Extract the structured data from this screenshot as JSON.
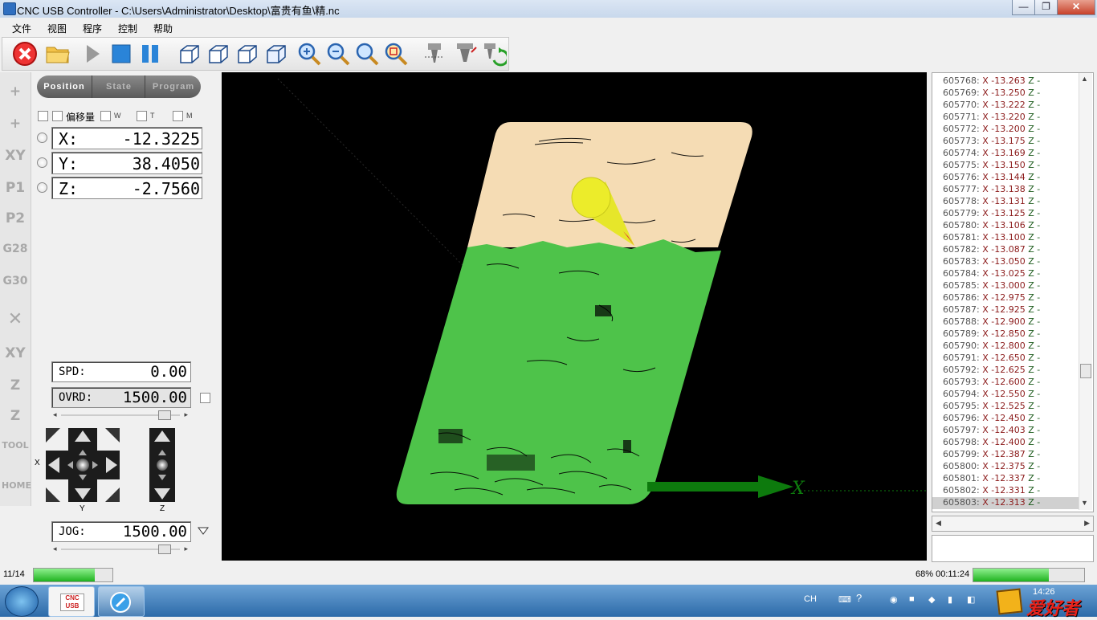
{
  "window": {
    "title": "CNC USB Controller - C:\\Users\\Administrator\\Desktop\\富贵有鱼\\精.nc",
    "minimize": "—",
    "maximize": "❐",
    "close": "✕"
  },
  "menu": [
    "文件",
    "视图",
    "程序",
    "控制",
    "帮助"
  ],
  "toolbar": {
    "icons": [
      "stop-icon",
      "open-folder-icon",
      "play-icon",
      "stop-square-icon",
      "pause-icon",
      "view-iso-icon",
      "view-front-icon",
      "view-side-icon",
      "view-top-icon",
      "zoom-in-icon",
      "zoom-out-icon",
      "zoom-fit-icon",
      "zoom-window-icon",
      "tool-path-icon",
      "tool-icon",
      "refresh-icon"
    ]
  },
  "left_strip": [
    "+",
    "+",
    "XY",
    "P1",
    "P2",
    "G28",
    "G30",
    "✕",
    "XY",
    "Z",
    "Z",
    "TOOL",
    "HOME"
  ],
  "tabs": [
    "Position",
    "State",
    "Program"
  ],
  "options": {
    "offset_label": "偏移量",
    "w": "W",
    "t": "T",
    "m": "M"
  },
  "position": {
    "x_label": "X:",
    "x_value": "-12.3225",
    "y_label": "Y:",
    "y_value": "38.4050",
    "z_label": "Z:",
    "z_value": "-2.7560"
  },
  "spindle": {
    "spd_label": "SPD:",
    "spd_value": "0.00",
    "ovrd_label": "OVRD:",
    "ovrd_value": "1500.00",
    "slider_position": 0.9
  },
  "jog": {
    "x_label": "X",
    "y_label": "Y",
    "z_label": "Z",
    "jog_label": "JOG:",
    "jog_value": "1500.00",
    "slider_position": 0.9
  },
  "viewport": {
    "axis_label": "X"
  },
  "gcode_lines": [
    {
      "ln": "605768:",
      "x": "X -13.263",
      "z": "Z -"
    },
    {
      "ln": "605769:",
      "x": "X -13.250",
      "z": "Z -"
    },
    {
      "ln": "605770:",
      "x": "X -13.222",
      "z": "Z -"
    },
    {
      "ln": "605771:",
      "x": "X -13.220",
      "z": "Z -"
    },
    {
      "ln": "605772:",
      "x": "X -13.200",
      "z": "Z -"
    },
    {
      "ln": "605773:",
      "x": "X -13.175",
      "z": "Z -"
    },
    {
      "ln": "605774:",
      "x": "X -13.169",
      "z": "Z -"
    },
    {
      "ln": "605775:",
      "x": "X -13.150",
      "z": "Z -"
    },
    {
      "ln": "605776:",
      "x": "X -13.144",
      "z": "Z -"
    },
    {
      "ln": "605777:",
      "x": "X -13.138",
      "z": "Z -"
    },
    {
      "ln": "605778:",
      "x": "X -13.131",
      "z": "Z -"
    },
    {
      "ln": "605779:",
      "x": "X -13.125",
      "z": "Z -"
    },
    {
      "ln": "605780:",
      "x": "X -13.106",
      "z": "Z -"
    },
    {
      "ln": "605781:",
      "x": "X -13.100",
      "z": "Z -"
    },
    {
      "ln": "605782:",
      "x": "X -13.087",
      "z": "Z -"
    },
    {
      "ln": "605783:",
      "x": "X -13.050",
      "z": "Z -"
    },
    {
      "ln": "605784:",
      "x": "X -13.025",
      "z": "Z -"
    },
    {
      "ln": "605785:",
      "x": "X -13.000",
      "z": "Z -"
    },
    {
      "ln": "605786:",
      "x": "X -12.975",
      "z": "Z -"
    },
    {
      "ln": "605787:",
      "x": "X -12.925",
      "z": "Z -"
    },
    {
      "ln": "605788:",
      "x": "X -12.900",
      "z": "Z -"
    },
    {
      "ln": "605789:",
      "x": "X -12.850",
      "z": "Z -"
    },
    {
      "ln": "605790:",
      "x": "X -12.800",
      "z": "Z -"
    },
    {
      "ln": "605791:",
      "x": "X -12.650",
      "z": "Z -"
    },
    {
      "ln": "605792:",
      "x": "X -12.625",
      "z": "Z -"
    },
    {
      "ln": "605793:",
      "x": "X -12.600",
      "z": "Z -"
    },
    {
      "ln": "605794:",
      "x": "X -12.550",
      "z": "Z -"
    },
    {
      "ln": "605795:",
      "x": "X -12.525",
      "z": "Z -"
    },
    {
      "ln": "605796:",
      "x": "X -12.450",
      "z": "Z -"
    },
    {
      "ln": "605797:",
      "x": "X -12.403",
      "z": "Z -"
    },
    {
      "ln": "605798:",
      "x": "X -12.400",
      "z": "Z -"
    },
    {
      "ln": "605799:",
      "x": "X -12.387",
      "z": "Z -"
    },
    {
      "ln": "605800:",
      "x": "X -12.375",
      "z": "Z -"
    },
    {
      "ln": "605801:",
      "x": "X -12.337",
      "z": "Z -"
    },
    {
      "ln": "605802:",
      "x": "X -12.331",
      "z": "Z -"
    },
    {
      "ln": "605803:",
      "x": "X -12.313",
      "z": "Z -"
    }
  ],
  "gcode_selected_index": 35,
  "status": {
    "file_progress": "11/14",
    "file_progress_fraction": 0.78,
    "job_progress": "68% 00:11:24",
    "job_progress_fraction": 0.68
  },
  "taskbar": {
    "apps": [
      "CNC USB",
      "browser"
    ],
    "lang": "CH",
    "clock": "14:26",
    "watermark": "爱好者"
  },
  "colors": {
    "material_top": "#f5dcb4",
    "material_cut": "#4ec34a",
    "tool": "#e6e62a",
    "tool_tip": "#e23a3a",
    "x_axis": "#0d7a0d"
  }
}
